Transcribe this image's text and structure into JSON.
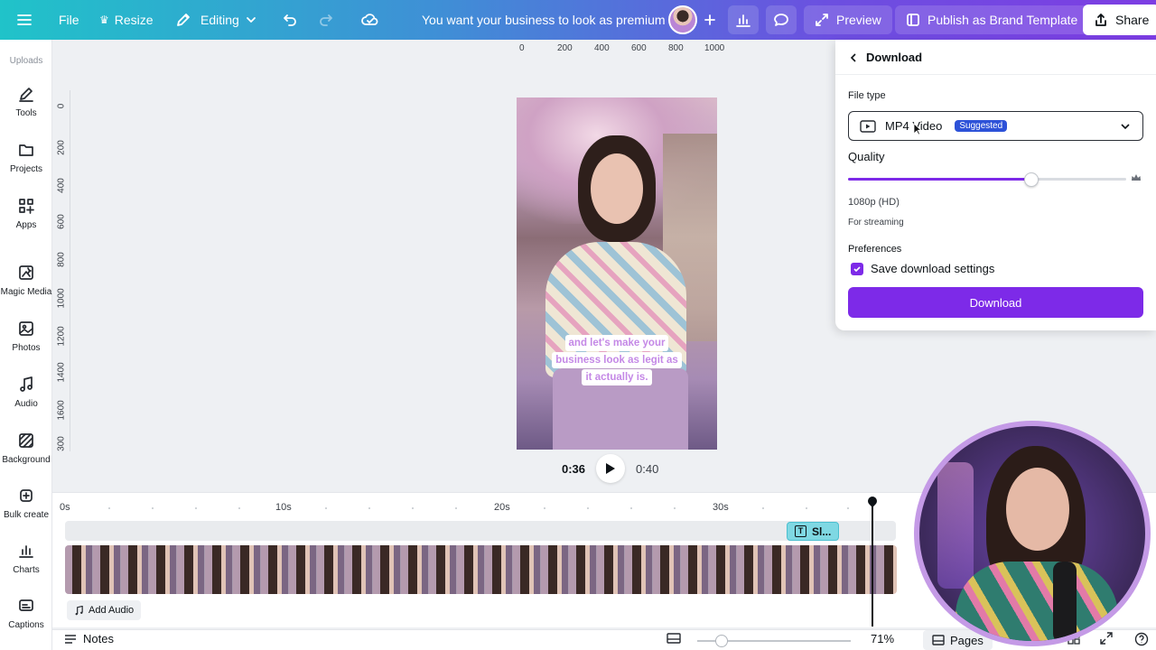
{
  "topbar": {
    "file": "File",
    "resize": "Resize",
    "editing": "Editing",
    "doc_title": "You want your business to look as premium",
    "preview": "Preview",
    "publish": "Publish as Brand Template",
    "share": "Share"
  },
  "sidebar": {
    "uploads": "Uploads",
    "items": [
      {
        "label": "Tools",
        "icon": "pen-icon"
      },
      {
        "label": "Projects",
        "icon": "folder-icon"
      },
      {
        "label": "Apps",
        "icon": "apps-grid-icon"
      },
      {
        "label": "Magic Media",
        "icon": "magic-media-icon"
      },
      {
        "label": "Photos",
        "icon": "photo-icon"
      },
      {
        "label": "Audio",
        "icon": "music-note-icon"
      },
      {
        "label": "Background",
        "icon": "background-pattern-icon"
      },
      {
        "label": "Bulk create",
        "icon": "bulk-create-icon"
      },
      {
        "label": "Charts",
        "icon": "chart-icon"
      },
      {
        "label": "Captions",
        "icon": "captions-icon"
      }
    ]
  },
  "canvas": {
    "ruler_top": [
      "0",
      "200",
      "400",
      "600",
      "800",
      "1000"
    ],
    "ruler_left": [
      "0",
      "200",
      "400",
      "600",
      "800",
      "1000",
      "1200",
      "1400",
      "1600",
      "300"
    ],
    "caption_lines": [
      "and let's make your",
      "business look as legit as",
      "it actually is."
    ],
    "current_time": "0:36",
    "total_time": "0:40"
  },
  "timeline": {
    "marks": [
      "0s",
      "10s",
      "20s",
      "30s"
    ],
    "text_chip": "Sl...",
    "add_audio": "Add Audio"
  },
  "bottombar": {
    "notes": "Notes",
    "zoom": "71%",
    "pages": "Pages"
  },
  "download_panel": {
    "title": "Download",
    "file_type_label": "File type",
    "file_type_value": "MP4 Video",
    "suggested_badge": "Suggested",
    "quality_label": "Quality",
    "quality_fraction": 0.66,
    "quality_resolution": "1080p (HD)",
    "quality_subtext": "For streaming",
    "preferences_label": "Preferences",
    "save_settings_label": "Save download settings",
    "save_settings_checked": true,
    "download_button": "Download"
  },
  "colors": {
    "accent": "#7d2ae8",
    "badge": "#2d52d8",
    "caption_text": "#c488e6"
  }
}
